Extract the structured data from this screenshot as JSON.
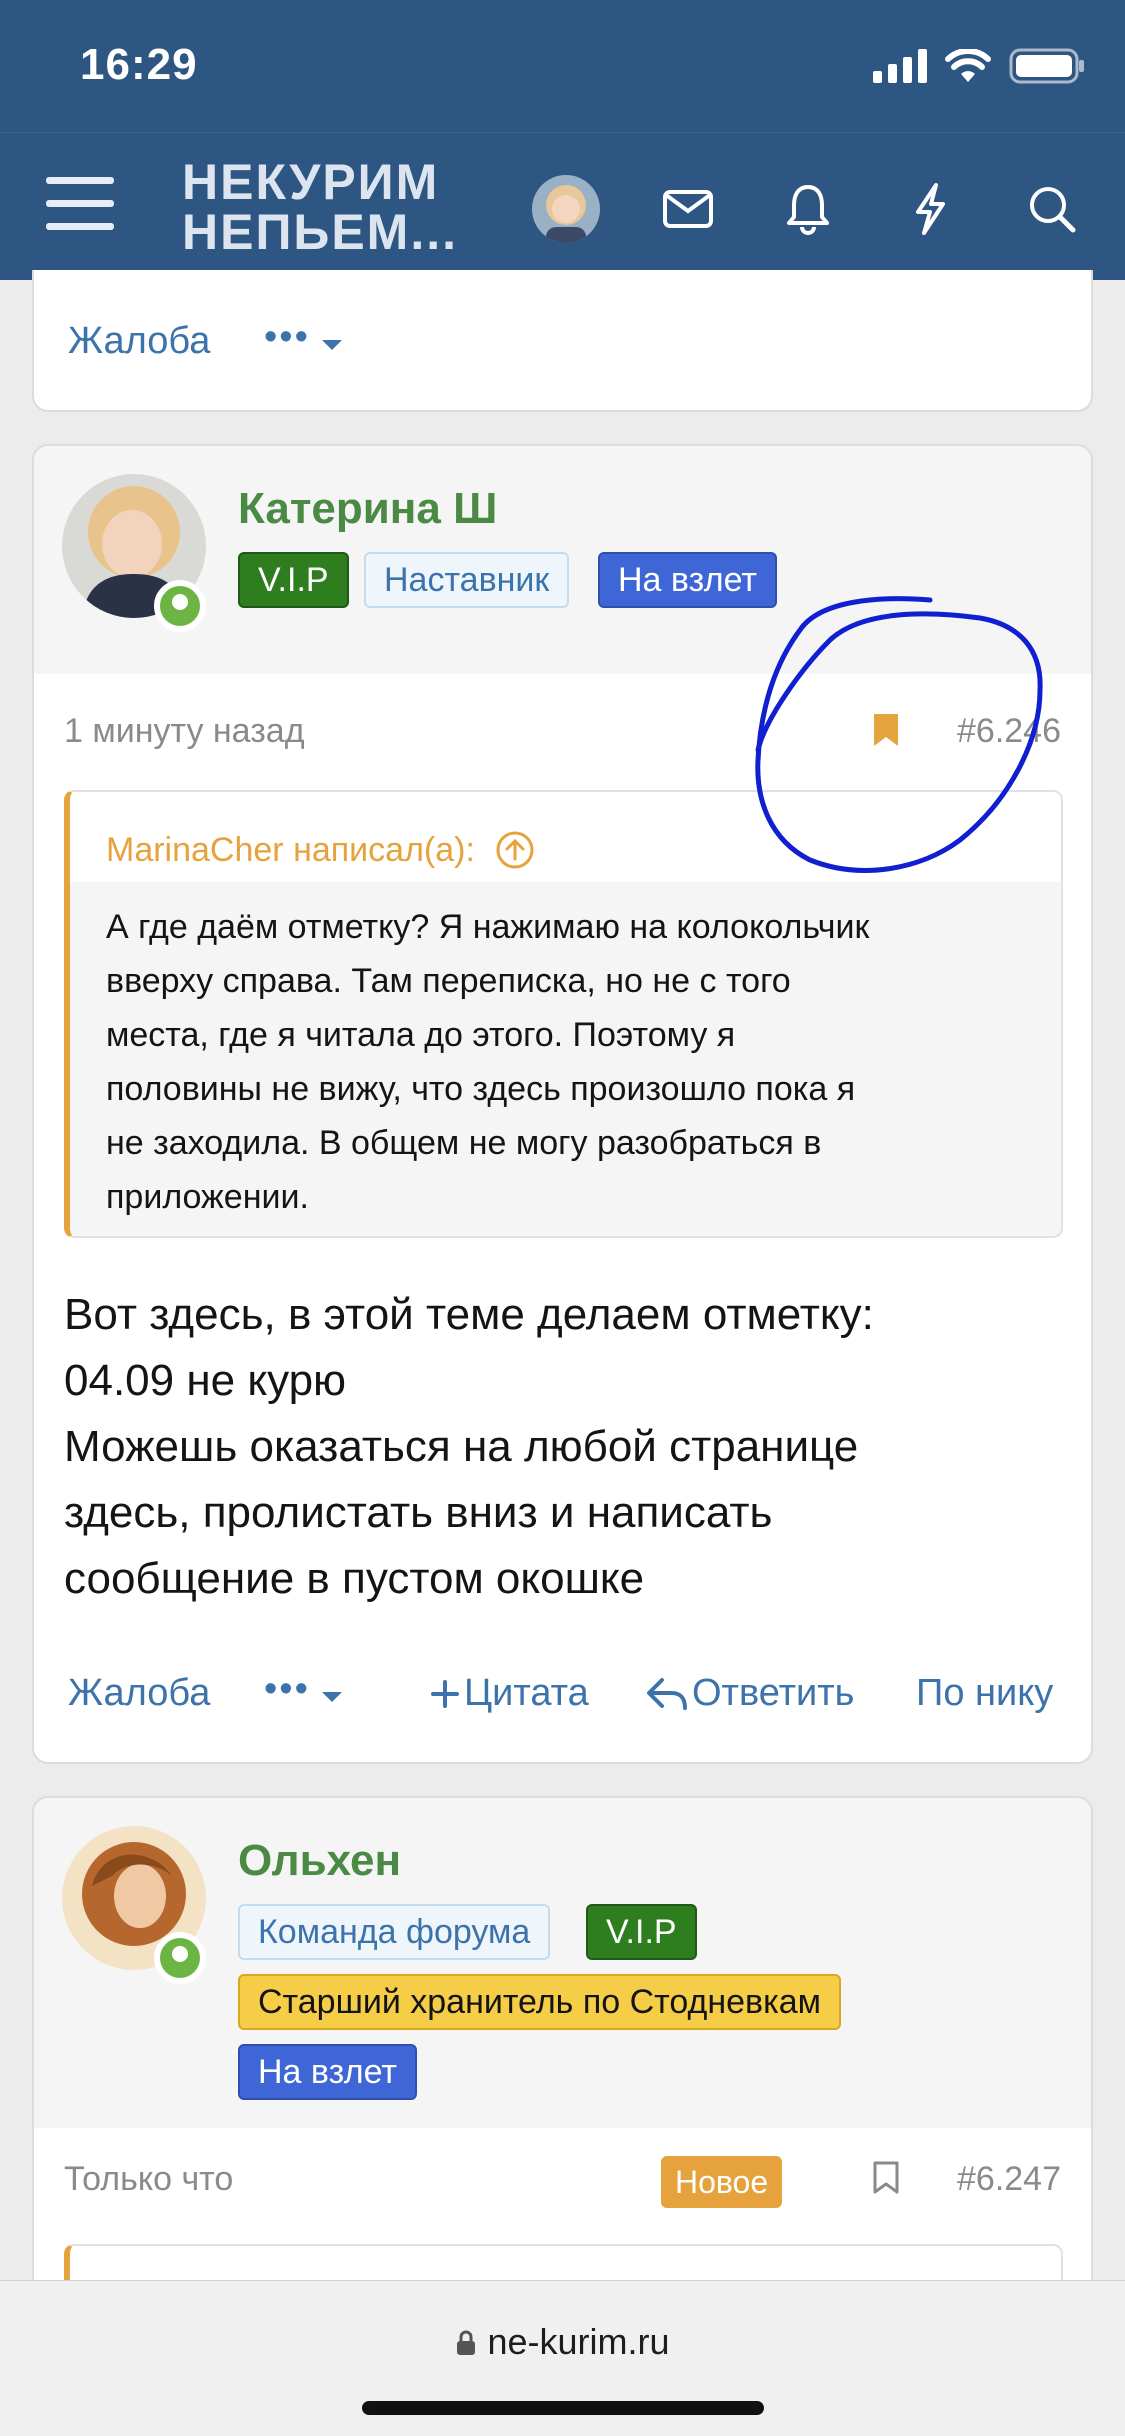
{
  "status_bar": {
    "time": "16:29"
  },
  "nav": {
    "logo": "НЕКУРИМ НЕПЬЕМ..."
  },
  "actions": {
    "report": "Жалоба",
    "more": "•••",
    "quote": "Цитата",
    "reply": "Ответить",
    "by_nick": "По нику"
  },
  "posts": [
    {
      "author": "Катерина Ш",
      "badges": [
        "V.I.P",
        "Наставник",
        "На взлет"
      ],
      "time": "1 минуту назад",
      "number": "#6.246",
      "quote": {
        "author": "MarinaCher написал(а):",
        "lines": [
          "А где даём отметку? Я нажимаю на колокольчик",
          "вверху справа. Там переписка, но не с того",
          "места, где я читала до этого. Поэтому я",
          "половины не вижу, что здесь произошло пока я",
          "не заходила. В общем не могу разобраться в",
          "приложении."
        ]
      },
      "text_lines": [
        "Вот здесь, в этой теме делаем отметку:",
        "04.09 не курю",
        "Можешь оказаться на любой странице",
        "здесь, пролистать вниз и написать",
        "сообщение в пустом окошке"
      ]
    },
    {
      "author": "Ольхен",
      "badges": [
        "Команда форума",
        "V.I.P",
        "Старший хранитель по Стодневкам",
        "На взлет"
      ],
      "time": "Только что",
      "new_label": "Новое",
      "number": "#6.247"
    }
  ],
  "browser": {
    "url": "ne-kurim.ru"
  },
  "colors": {
    "header": "#2e5683",
    "accent": "#e6a23c",
    "link": "#3c73ab",
    "username": "#4a8a44",
    "annotation": "#1020d0"
  }
}
